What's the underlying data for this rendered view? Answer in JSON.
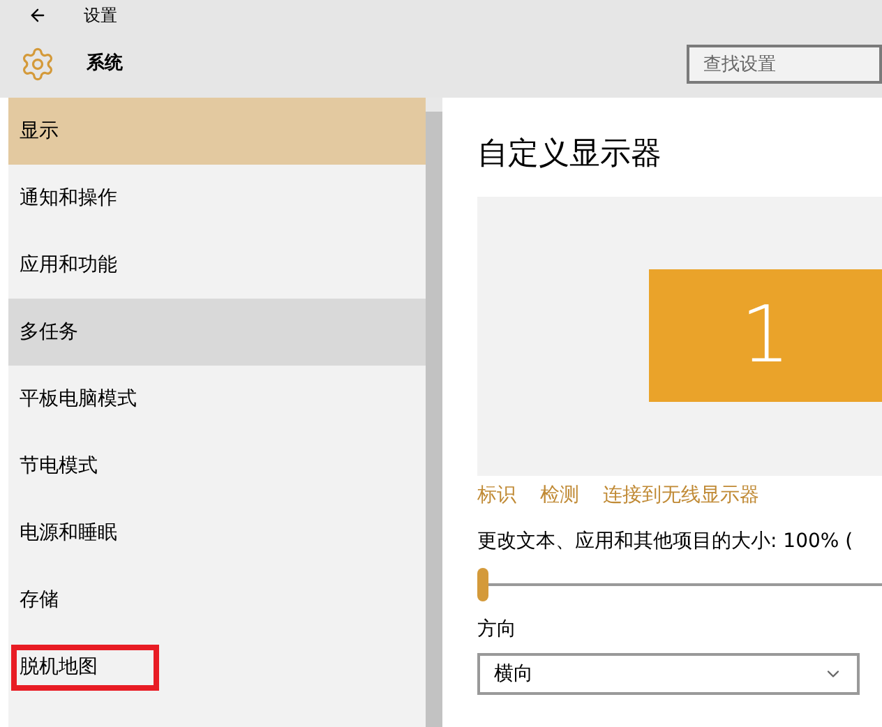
{
  "window": {
    "title": "设置"
  },
  "header": {
    "title": "系统"
  },
  "search": {
    "placeholder": "查找设置"
  },
  "sidebar": {
    "items": [
      {
        "label": "显示",
        "selected": true,
        "hovered": false,
        "annotated": false
      },
      {
        "label": "通知和操作",
        "selected": false,
        "hovered": false,
        "annotated": false
      },
      {
        "label": "应用和功能",
        "selected": false,
        "hovered": false,
        "annotated": false
      },
      {
        "label": "多任务",
        "selected": false,
        "hovered": true,
        "annotated": false
      },
      {
        "label": "平板电脑模式",
        "selected": false,
        "hovered": false,
        "annotated": false
      },
      {
        "label": "节电模式",
        "selected": false,
        "hovered": false,
        "annotated": false
      },
      {
        "label": "电源和睡眠",
        "selected": false,
        "hovered": false,
        "annotated": false
      },
      {
        "label": "存储",
        "selected": false,
        "hovered": false,
        "annotated": false
      },
      {
        "label": "脱机地图",
        "selected": false,
        "hovered": false,
        "annotated": true
      }
    ]
  },
  "content": {
    "title": "自定义显示器",
    "monitor": {
      "number": "1"
    },
    "links": [
      "标识",
      "检测",
      "连接到无线显示器"
    ],
    "scale": {
      "label": "更改文本、应用和其他项目的大小: 100% (",
      "level": 0
    },
    "orientation": {
      "label": "方向",
      "value": "横向"
    }
  }
}
